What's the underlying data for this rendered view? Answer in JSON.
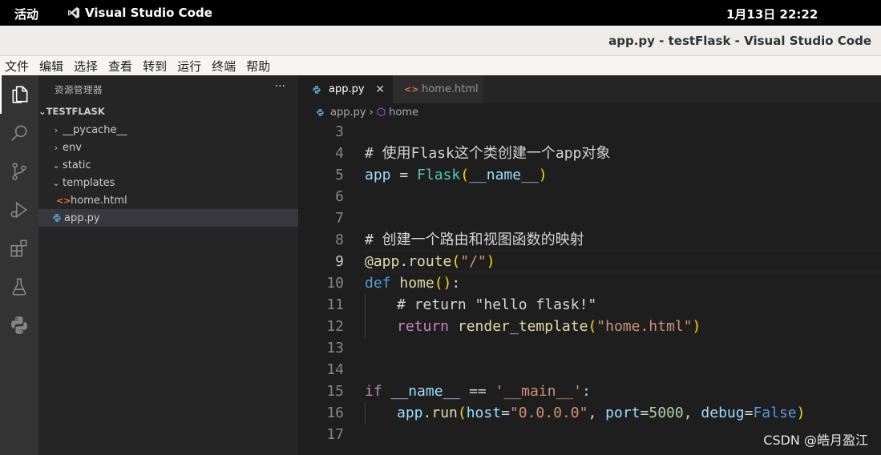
{
  "topbar": {
    "activities": "活动",
    "app_name": "Visual Studio Code",
    "clock": "1月13日  22:22"
  },
  "window": {
    "title": "app.py - testFlask - Visual Studio Code"
  },
  "menu": [
    "文件",
    "编辑",
    "选择",
    "查看",
    "转到",
    "运行",
    "终端",
    "帮助"
  ],
  "activity_bar": [
    "explorer-icon",
    "search-icon",
    "source-control-icon",
    "run-debug-icon",
    "extensions-icon",
    "testing-icon",
    "python-icon"
  ],
  "sidebar": {
    "header": "资源管理器",
    "more": "···",
    "folder": "TESTFLASK",
    "tree": [
      {
        "label": "__pycache__",
        "type": "folder",
        "expanded": false
      },
      {
        "label": "env",
        "type": "folder",
        "expanded": false
      },
      {
        "label": "static",
        "type": "folder",
        "expanded": true
      },
      {
        "label": "templates",
        "type": "folder",
        "expanded": true
      },
      {
        "label": "home.html",
        "type": "html"
      },
      {
        "label": "app.py",
        "type": "py",
        "selected": true
      }
    ]
  },
  "editor": {
    "tabs": [
      {
        "label": "app.py",
        "active": true,
        "close": "✕"
      },
      {
        "label": "home.html",
        "active": false
      }
    ],
    "breadcrumb": {
      "file": "app.py",
      "sep": "›",
      "symbol": "home"
    },
    "current_line": "9",
    "lines": [
      {
        "n": "3"
      },
      {
        "n": "4"
      },
      {
        "n": "5"
      },
      {
        "n": "6"
      },
      {
        "n": "7"
      },
      {
        "n": "8"
      },
      {
        "n": "9"
      },
      {
        "n": "10"
      },
      {
        "n": "11"
      },
      {
        "n": "12"
      },
      {
        "n": "13"
      },
      {
        "n": "14"
      },
      {
        "n": "15"
      },
      {
        "n": "16"
      },
      {
        "n": "17"
      }
    ],
    "code": {
      "l4": "# 使用Flask这个类创建一个app对象",
      "l5_var": "app",
      "l5_eq": " = ",
      "l5_cls": "Flask",
      "l5_open": "(",
      "l5_arg": "__name__",
      "l5_close": ")",
      "l8": "# 创建一个路由和视图函数的映射",
      "l9_at": "@",
      "l9_fn": "app.route",
      "l9_open": "(",
      "l9_str": "\"/\"",
      "l9_close": ")",
      "l10_kw": "def",
      "l10_fn": "home",
      "l10_par": "()",
      "l10_colon": ":",
      "l11": "# return \"hello flask!\"",
      "l12_kw": "return",
      "l12_fn": "render_template",
      "l12_open": "(",
      "l12_str": "\"home.html\"",
      "l12_close": ")",
      "l15_kw": "if",
      "l15_var": "__name__",
      "l15_op": " == ",
      "l15_str": "'__main__'",
      "l15_colon": ":",
      "l16_var": "app",
      "l16_fn": "run",
      "l16_open": "(",
      "l16_p1": "host",
      "l16_v1": "\"0.0.0.0\"",
      "l16_p2": "port",
      "l16_v2": "5000",
      "l16_p3": "debug",
      "l16_v3": "False",
      "l16_close": ")"
    }
  },
  "watermark": "CSDN @皓月盈江"
}
